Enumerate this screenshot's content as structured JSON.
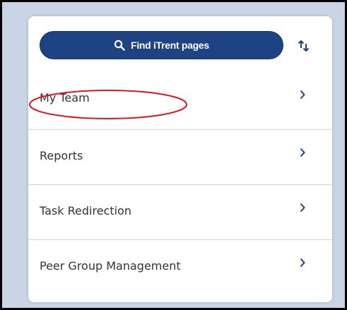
{
  "search": {
    "label": "Find iTrent pages",
    "icon": "search-icon"
  },
  "sort": {
    "icon": "sort-arrows-icon"
  },
  "menu": {
    "items": [
      {
        "label": "My Team",
        "icon": "chevron-right-icon",
        "highlighted": true
      },
      {
        "label": "Reports",
        "icon": "chevron-right-icon"
      },
      {
        "label": "Task Redirection",
        "icon": "chevron-right-icon"
      },
      {
        "label": "Peer Group Management",
        "icon": "chevron-right-icon"
      }
    ]
  },
  "colors": {
    "primary": "#1d4383",
    "chevron": "#1d4383",
    "highlight_circle": "#e0161e",
    "background": "#c9d4e5",
    "text": "#333333"
  }
}
